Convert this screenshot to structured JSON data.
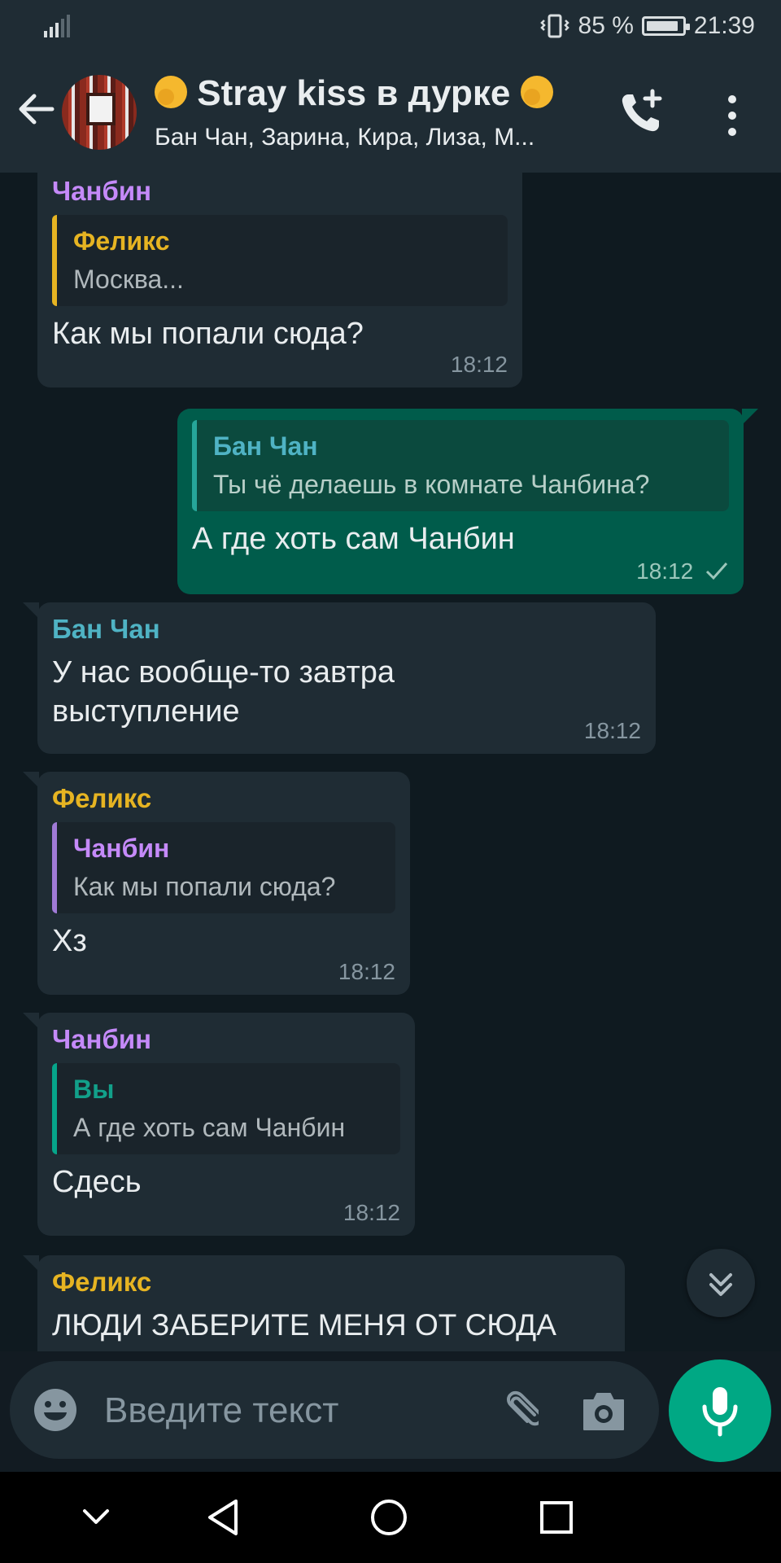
{
  "status_bar": {
    "battery_percent": "85 %",
    "time": "21:39"
  },
  "header": {
    "title": "Stray kiss в дурке",
    "subtitle": "Бан Чан, Зарина, Кира, Лиза, М..."
  },
  "messages": [
    {
      "direction": "in",
      "sender": "Чанбин",
      "quote_name": "Феликс",
      "quote_text": "Москва...",
      "text": "Как мы попали сюда?",
      "time": "18:12"
    },
    {
      "direction": "out",
      "quote_name": "Бан Чан",
      "quote_text": "Ты чё делаешь в комнате Чанбина?",
      "text": "А где хоть сам Чанбин",
      "time": "18:12",
      "status": "sent"
    },
    {
      "direction": "in",
      "sender": "Бан Чан",
      "text_line1": "У нас вообще-то завтра",
      "text_line2": "выступление",
      "time": "18:12"
    },
    {
      "direction": "in",
      "sender": "Феликс",
      "quote_name": "Чанбин",
      "quote_text": "Как мы попали сюда?",
      "text": "Хз",
      "time": "18:12"
    },
    {
      "direction": "in",
      "sender": "Чанбин",
      "quote_name": "Вы",
      "quote_text": "А где хоть сам Чанбин",
      "text": "Сдесь",
      "time": "18:12"
    },
    {
      "direction": "in",
      "sender": "Феликс",
      "text": "ЛЮДИ ЗАБЕРИТЕ МЕНЯ ОТ СЮДА"
    }
  ],
  "input": {
    "placeholder": "Введите текст"
  },
  "icons": {
    "back": "arrow-left-icon",
    "call": "add-call-icon",
    "menu": "more-vert-icon",
    "emoji": "emoji-icon",
    "attach": "paperclip-icon",
    "camera": "camera-icon",
    "mic": "microphone-icon",
    "scroll_down": "double-chevron-down-icon"
  },
  "colors": {
    "background": "#121b22",
    "header": "#1f2c34",
    "incoming_bubble": "#1f2c34",
    "outgoing_bubble": "#005c4b",
    "accent": "#00a884"
  }
}
